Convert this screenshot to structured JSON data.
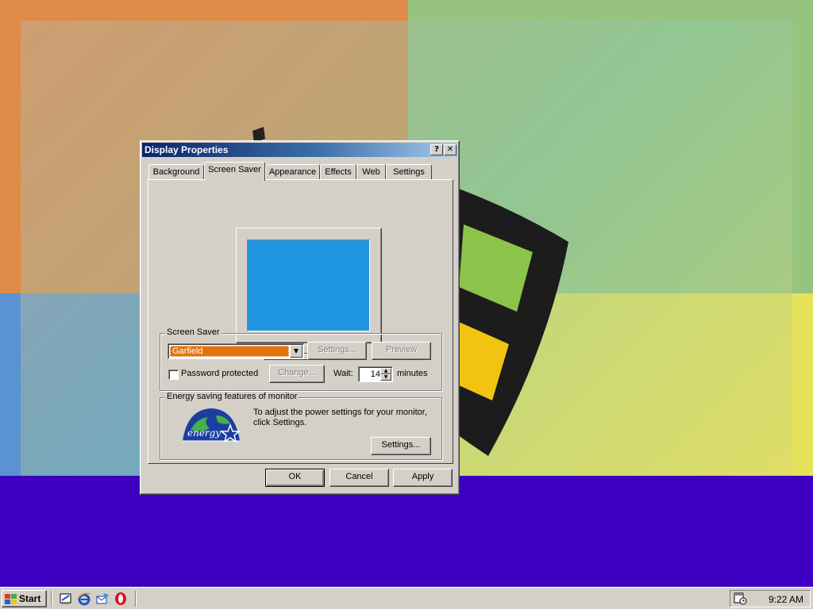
{
  "dialog": {
    "title": "Display Properties",
    "help_button": "?",
    "close_button": "✕",
    "tabs": [
      {
        "label": "Background",
        "active": false
      },
      {
        "label": "Screen Saver",
        "active": true
      },
      {
        "label": "Appearance",
        "active": false
      },
      {
        "label": "Effects",
        "active": false
      },
      {
        "label": "Web",
        "active": false
      },
      {
        "label": "Settings",
        "active": false
      }
    ],
    "screen_saver": {
      "group_label": "Screen Saver",
      "selected": "Garfield",
      "settings_button": "Settings...",
      "preview_button": "Preview",
      "password_label": "Password protected",
      "password_checked": false,
      "change_button": "Change...",
      "wait_label": "Wait:",
      "wait_value": "14",
      "minutes_label": "minutes"
    },
    "energy": {
      "group_label": "Energy saving features of monitor",
      "logo_text": "energy",
      "description": "To adjust the power settings for your monitor, click Settings.",
      "settings_button": "Settings..."
    },
    "buttons": {
      "ok": "OK",
      "cancel": "Cancel",
      "apply": "Apply"
    },
    "preview_screen_color": "#2196e0"
  },
  "taskbar": {
    "start_label": "Start",
    "quick_launch": [
      "desktop-icon",
      "internet-explorer-icon",
      "outlook-express-icon",
      "opera-icon"
    ],
    "clock": "9:22 AM",
    "tray_icons": [
      "scheduler-icon"
    ]
  },
  "colors": {
    "desktop_background": "#3d00c0",
    "titlebar_start": "#0a246a",
    "titlebar_end": "#a6caf0",
    "selection_highlight": "#e2740e"
  }
}
